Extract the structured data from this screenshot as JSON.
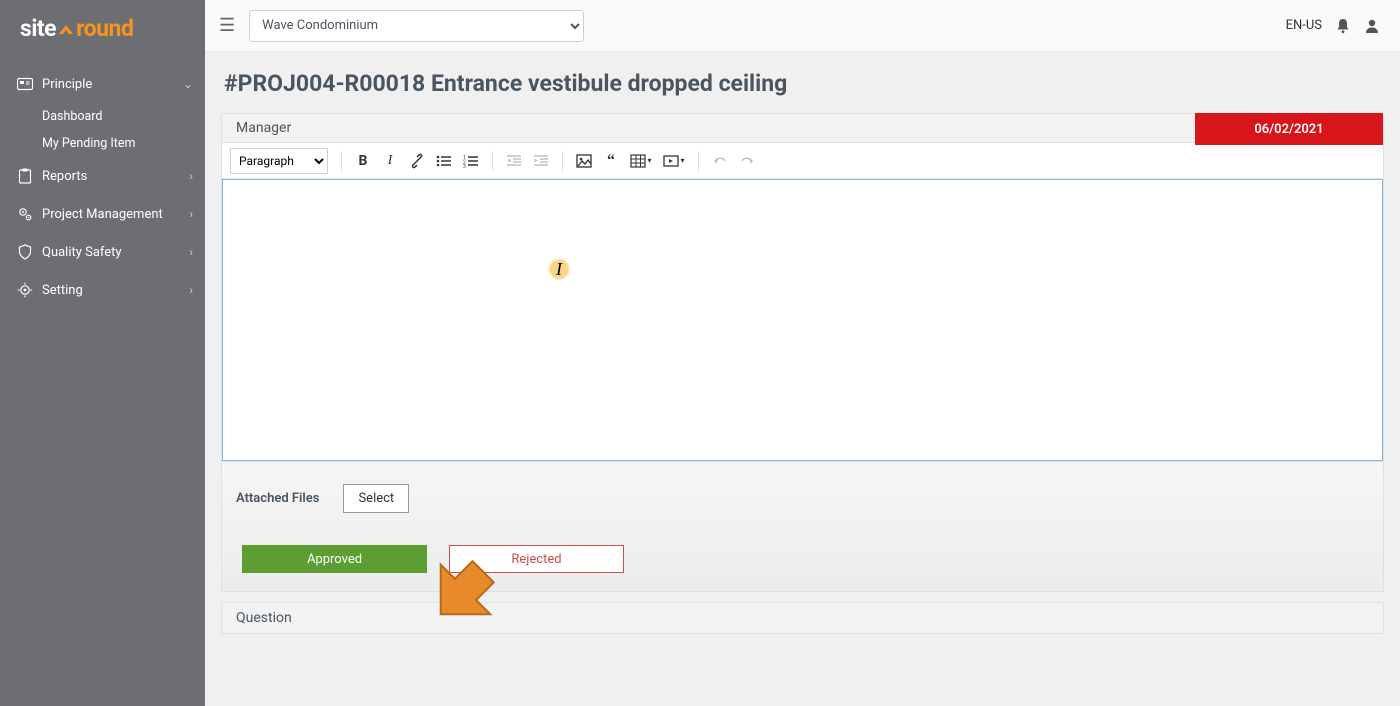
{
  "logo": {
    "part1": "site",
    "part2": "round"
  },
  "sidebar": {
    "principle": {
      "label": "Principle"
    },
    "principle_children": {
      "dashboard": "Dashboard",
      "pending": "My Pending Item"
    },
    "reports": "Reports",
    "project_mgmt": "Project Management",
    "quality_safety": "Quality Safety",
    "setting": "Setting"
  },
  "topbar": {
    "project": "Wave Condominium",
    "lang": "EN-US"
  },
  "page": {
    "title": "#PROJ004-R00018 Entrance vestibule dropped ceiling"
  },
  "panel": {
    "header": "Manager",
    "date": "06/02/2021"
  },
  "editor": {
    "format": "Paragraph"
  },
  "attach": {
    "label": "Attached Files",
    "select": "Select"
  },
  "actions": {
    "approved": "Approved",
    "rejected": "Rejected"
  },
  "question": {
    "header": "Question"
  }
}
